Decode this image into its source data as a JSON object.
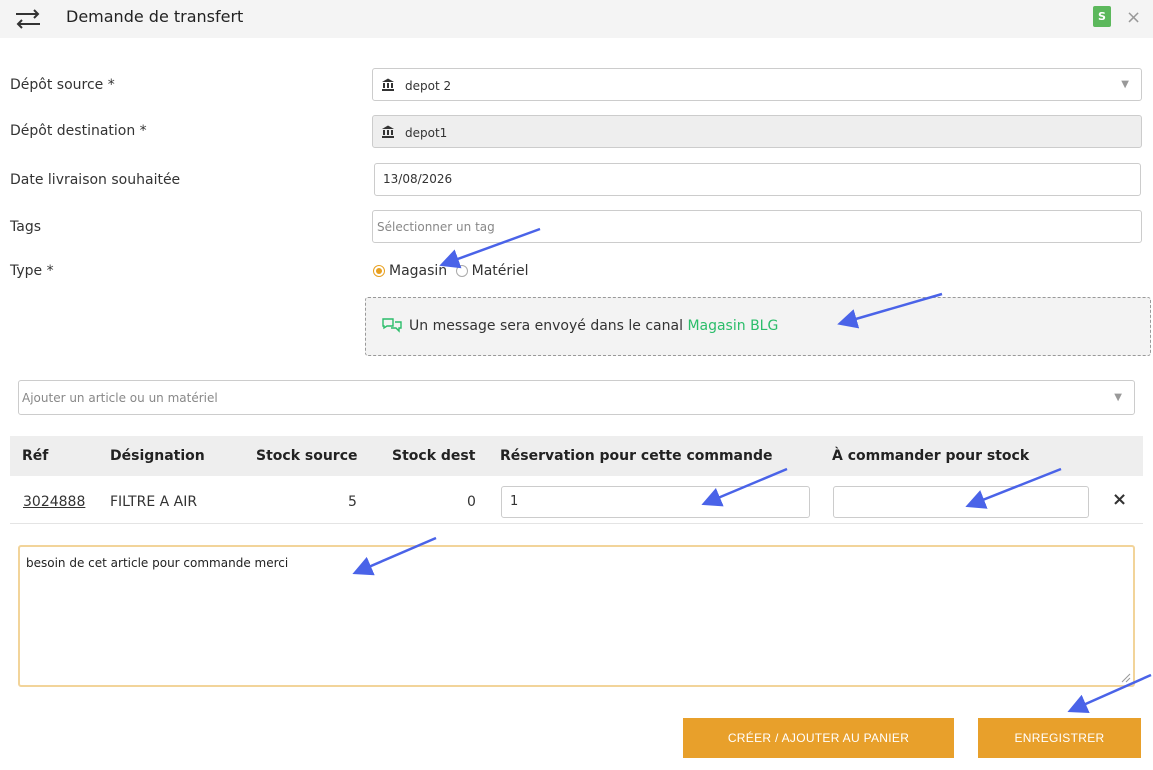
{
  "header": {
    "title": "Demande de transfert",
    "badge": "S",
    "close": "×"
  },
  "form": {
    "source_label": "Dépôt source *",
    "source_value": "depot 2",
    "destination_label": "Dépôt destination *",
    "destination_value": "depot1",
    "date_label": "Date livraison souhaitée",
    "date_value": "13/08/2026",
    "tags_label": "Tags",
    "tags_placeholder": "Sélectionner un tag",
    "type_label": "Type *",
    "type_options": [
      "Magasin",
      "Matériel"
    ],
    "type_selected": "Magasin"
  },
  "info": {
    "message": "Un message sera envoyé dans le canal",
    "channel": "Magasin BLG",
    "channel_color": "#2bbd6a"
  },
  "article_select": {
    "placeholder": "Ajouter un article ou un matériel"
  },
  "table": {
    "headers": [
      "Réf",
      "Désignation",
      "Stock source",
      "Stock dest",
      "Réservation pour cette commande",
      "À commander pour stock"
    ],
    "rows": [
      {
        "ref": "3024888",
        "designation": "FILTRE A AIR",
        "stock_source": "5",
        "stock_dest": "0",
        "reservation": "1",
        "a_commander": ""
      }
    ]
  },
  "notes": {
    "text": "besoin de cet article pour commande merci"
  },
  "buttons": {
    "create": "CRÉER / AJOUTER AU PANIER",
    "save": "ENREGISTRER"
  },
  "colors": {
    "accent": "#e8a02b",
    "badge": "#5cb85c",
    "annotation_arrow": "#4a63e8"
  }
}
